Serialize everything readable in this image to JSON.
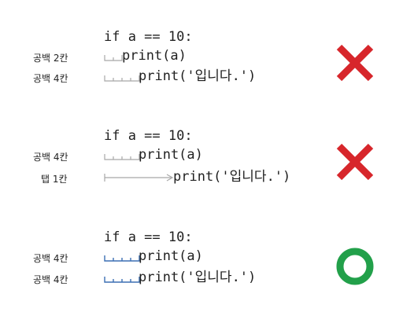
{
  "examples": [
    {
      "header": "if a == 10:",
      "lines": [
        {
          "label": "공백 2칸",
          "code": "print(a)"
        },
        {
          "label": "공백 4칸",
          "code": "print('입니다.')"
        }
      ],
      "result": "wrong"
    },
    {
      "header": "if a == 10:",
      "lines": [
        {
          "label": "공백 4칸",
          "code": "print(a)"
        },
        {
          "label": "탭 1칸",
          "code": "print('입니다.')"
        }
      ],
      "result": "wrong"
    },
    {
      "header": "if a == 10:",
      "lines": [
        {
          "label": "공백 4칸",
          "code": "print(a)"
        },
        {
          "label": "공백 4칸",
          "code": "print('입니다.')"
        }
      ],
      "result": "correct"
    }
  ],
  "colors": {
    "cross": "#d7262b",
    "circle": "#22a04a",
    "space_marker_gray": "#a8a8a8",
    "space_marker_blue": "#3c6fb4",
    "text": "#1f1f1f"
  }
}
